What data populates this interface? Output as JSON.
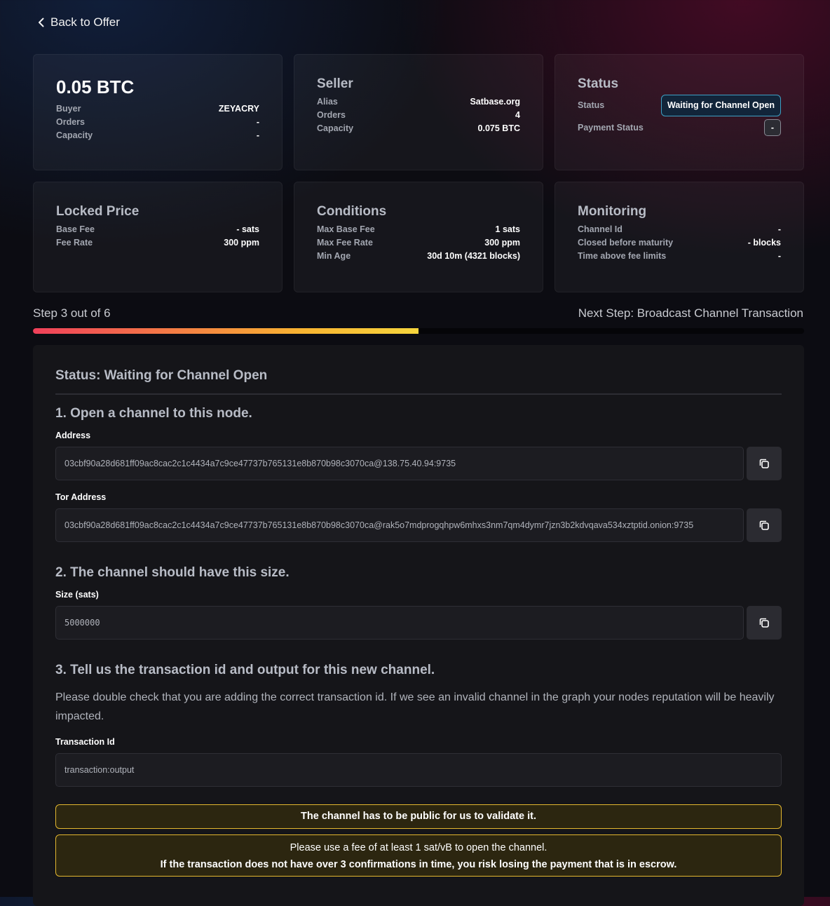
{
  "nav": {
    "back_label": "Back to Offer"
  },
  "cards": {
    "amount": {
      "title": "0.05 BTC",
      "rows": [
        {
          "k": "Buyer",
          "v": "ZEYACRY"
        },
        {
          "k": "Orders",
          "v": "-"
        },
        {
          "k": "Capacity",
          "v": "-"
        }
      ]
    },
    "seller": {
      "title": "Seller",
      "rows": [
        {
          "k": "Alias",
          "v": "Satbase.org"
        },
        {
          "k": "Orders",
          "v": "4"
        },
        {
          "k": "Capacity",
          "v": "0.075 BTC"
        }
      ]
    },
    "status": {
      "title": "Status",
      "status_label": "Status",
      "status_value": "Waiting for Channel Open",
      "payment_label": "Payment Status",
      "payment_value": "-"
    },
    "locked_price": {
      "title": "Locked Price",
      "rows": [
        {
          "k": "Base Fee",
          "v": "- sats"
        },
        {
          "k": "Fee Rate",
          "v": "300 ppm"
        }
      ]
    },
    "conditions": {
      "title": "Conditions",
      "rows": [
        {
          "k": "Max Base Fee",
          "v": "1 sats"
        },
        {
          "k": "Max Fee Rate",
          "v": "300 ppm"
        },
        {
          "k": "Min Age",
          "v": "30d 10m (4321 blocks)"
        }
      ]
    },
    "monitoring": {
      "title": "Monitoring",
      "rows": [
        {
          "k": "Channel Id",
          "v": "-"
        },
        {
          "k": "Closed before maturity",
          "v": "- blocks"
        },
        {
          "k": "Time above fee limits",
          "v": "-"
        }
      ]
    }
  },
  "progress": {
    "step_text": "Step 3 out of 6",
    "next_text": "Next Step: Broadcast Channel Transaction",
    "fraction": 0.5
  },
  "panel": {
    "title": "Status: Waiting for Channel Open",
    "step1": {
      "heading": "1. Open a channel to this node.",
      "address_label": "Address",
      "address_value": "03cbf90a28d681ff09ac8cac2c1c4434a7c9ce47737b765131e8b870b98c3070ca@138.75.40.94:9735",
      "tor_label": "Tor Address",
      "tor_value": "03cbf90a28d681ff09ac8cac2c1c4434a7c9ce47737b765131e8b870b98c3070ca@rak5o7mdprogqhpw6mhxs3nm7qm4dymr7jzn3b2kdvqava534xztptid.onion:9735"
    },
    "step2": {
      "heading": "2. The channel should have this size.",
      "size_label": "Size (sats)",
      "size_value": "5000000"
    },
    "step3": {
      "heading": "3. Tell us the transaction id and output for this new channel.",
      "paragraph": "Please double check that you are adding the correct transaction id. If we see an invalid channel in the graph your nodes reputation will be heavily impacted.",
      "txid_label": "Transaction Id",
      "txid_placeholder": "transaction:output"
    },
    "warnings": {
      "public": "The channel has to be public for us to validate it.",
      "fee_line": "Please use a fee of at least 1 sat/vB to open the channel.",
      "confirm_line": "If the transaction does not have over 3 confirmations in time, you risk losing the payment that is in escrow."
    }
  }
}
